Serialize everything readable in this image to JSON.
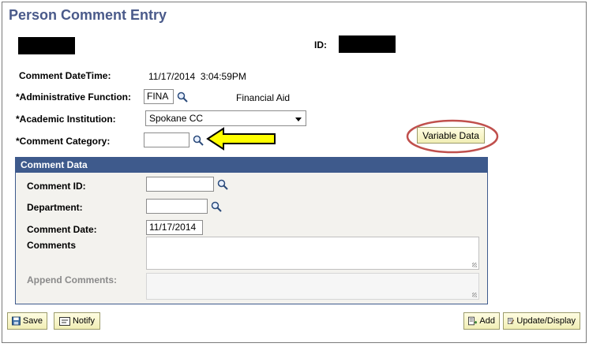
{
  "page": {
    "title": "Person Comment Entry",
    "id_label": "ID:"
  },
  "form": {
    "comment_datetime_label": "Comment DateTime:",
    "comment_datetime_value": "11/17/2014  3:04:59PM",
    "admin_function_label": "*Administrative Function:",
    "admin_function_value": "FINA",
    "admin_function_desc": "Financial Aid",
    "academic_institution_label": "*Academic Institution:",
    "academic_institution_value": "Spokane CC",
    "comment_category_label": "*Comment Category:",
    "comment_category_value": "",
    "variable_data_button": "Variable Data"
  },
  "comment_data": {
    "header": "Comment Data",
    "comment_id_label": "Comment ID:",
    "comment_id_value": "",
    "department_label": "Department:",
    "department_value": "",
    "comment_date_label": "Comment Date:",
    "comment_date_value": "11/17/2014",
    "comments_label": "Comments",
    "append_comments_label": "Append Comments:"
  },
  "toolbar": {
    "save_label": "Save",
    "notify_label": "Notify",
    "add_label": "Add",
    "update_display_label": "Update/Display"
  },
  "colors": {
    "title": "#4a5a8a",
    "group_header": "#3e5a8c",
    "annotation_arrow": "#ffff00",
    "annotation_circle": "#c0504d"
  }
}
